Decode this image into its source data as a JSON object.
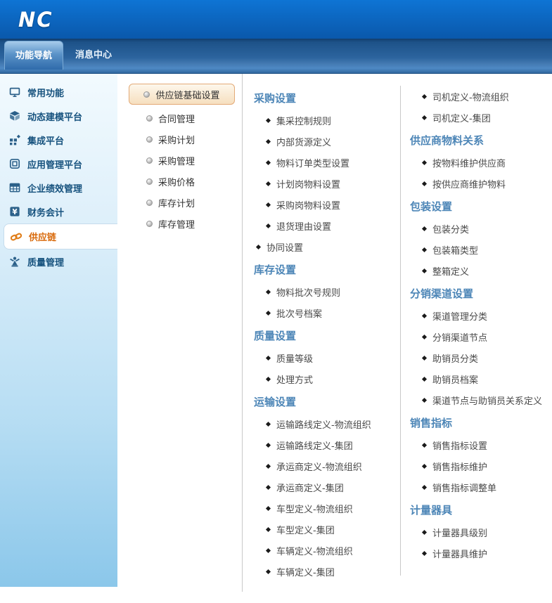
{
  "header": {
    "logo": "NC"
  },
  "tabs": [
    {
      "name": "function-navigation",
      "label": "功能导航",
      "active": true
    },
    {
      "name": "message-center",
      "label": "消息中心",
      "active": false
    }
  ],
  "sidebar": {
    "items": [
      {
        "name": "common-functions",
        "label": "常用功能",
        "icon": "monitor-icon",
        "active": false
      },
      {
        "name": "dynamic-modeling-platform",
        "label": "动态建模平台",
        "icon": "cube-icon",
        "active": false
      },
      {
        "name": "integration-platform",
        "label": "集成平台",
        "icon": "grid-dots-icon",
        "active": false
      },
      {
        "name": "application-management-platform",
        "label": "应用管理平台",
        "icon": "app-window-icon",
        "active": false
      },
      {
        "name": "enterprise-performance-management",
        "label": "企业绩效管理",
        "icon": "table-icon",
        "active": false
      },
      {
        "name": "financial-accounting",
        "label": "财务会计",
        "icon": "yuan-icon",
        "active": false
      },
      {
        "name": "supply-chain",
        "label": "供应链",
        "icon": "chain-icon",
        "active": true
      },
      {
        "name": "quality-management",
        "label": "质量管理",
        "icon": "person-award-icon",
        "active": false
      }
    ]
  },
  "submenu": {
    "items": [
      {
        "name": "supply-chain-basic-settings",
        "label": "供应链基础设置",
        "active": true
      },
      {
        "name": "contract-management",
        "label": "合同管理",
        "active": false
      },
      {
        "name": "purchase-plan",
        "label": "采购计划",
        "active": false
      },
      {
        "name": "purchase-management",
        "label": "采购管理",
        "active": false
      },
      {
        "name": "purchase-price",
        "label": "采购价格",
        "active": false
      },
      {
        "name": "inventory-plan",
        "label": "库存计划",
        "active": false
      },
      {
        "name": "inventory-management",
        "label": "库存管理",
        "active": false
      }
    ]
  },
  "main": {
    "columns": [
      {
        "groups": [
          {
            "heading": "采购设置",
            "items": [
              "集采控制规则",
              "内部货源定义",
              "物料订单类型设置",
              "计划岗物料设置",
              "采购岗物料设置",
              "退货理由设置",
              {
                "label": "协同设置",
                "outdent": true
              }
            ]
          },
          {
            "heading": "库存设置",
            "items": [
              "物料批次号规则",
              "批次号档案"
            ]
          },
          {
            "heading": "质量设置",
            "items": [
              "质量等级",
              "处理方式"
            ]
          },
          {
            "heading": "运输设置",
            "items": [
              "运输路线定义-物流组织",
              "运输路线定义-集团",
              "承运商定义-物流组织",
              "承运商定义-集团",
              "车型定义-物流组织",
              "车型定义-集团",
              "车辆定义-物流组织",
              "车辆定义-集团"
            ]
          }
        ]
      },
      {
        "groups": [
          {
            "heading": null,
            "items": [
              "司机定义-物流组织",
              "司机定义-集团"
            ]
          },
          {
            "heading": "供应商物料关系",
            "items": [
              "按物料维护供应商",
              "按供应商维护物料"
            ]
          },
          {
            "heading": "包装设置",
            "items": [
              "包装分类",
              "包装箱类型",
              "整箱定义"
            ]
          },
          {
            "heading": "分销渠道设置",
            "items": [
              "渠道管理分类",
              "分销渠道节点",
              "助销员分类",
              "助销员档案",
              "渠道节点与助销员关系定义"
            ]
          },
          {
            "heading": "销售指标",
            "items": [
              "销售指标设置",
              "销售指标维护",
              "销售指标调整单"
            ]
          },
          {
            "heading": "计量器具",
            "items": [
              "计量器具级别",
              "计量器具维护"
            ]
          }
        ]
      }
    ]
  },
  "colors": {
    "header-blue-top": "#0e74d4",
    "header-blue-bottom": "#0a58ab",
    "active-tab-top": "#a6cbeb",
    "active-tab-bottom": "#2f6bab",
    "sidebar-top": "#f2fafe",
    "sidebar-bottom": "#8bc7ea",
    "sidebar-text": "#16527e",
    "accent-orange": "#d8690a",
    "highlight-bg-top": "#fdf7ec",
    "highlight-bg-bottom": "#f6dfbf",
    "highlight-border": "#e3aa77",
    "heading-blue": "#4d86b7",
    "link-gray": "#4a4a4a",
    "divider-gray": "#c9c9c9"
  }
}
